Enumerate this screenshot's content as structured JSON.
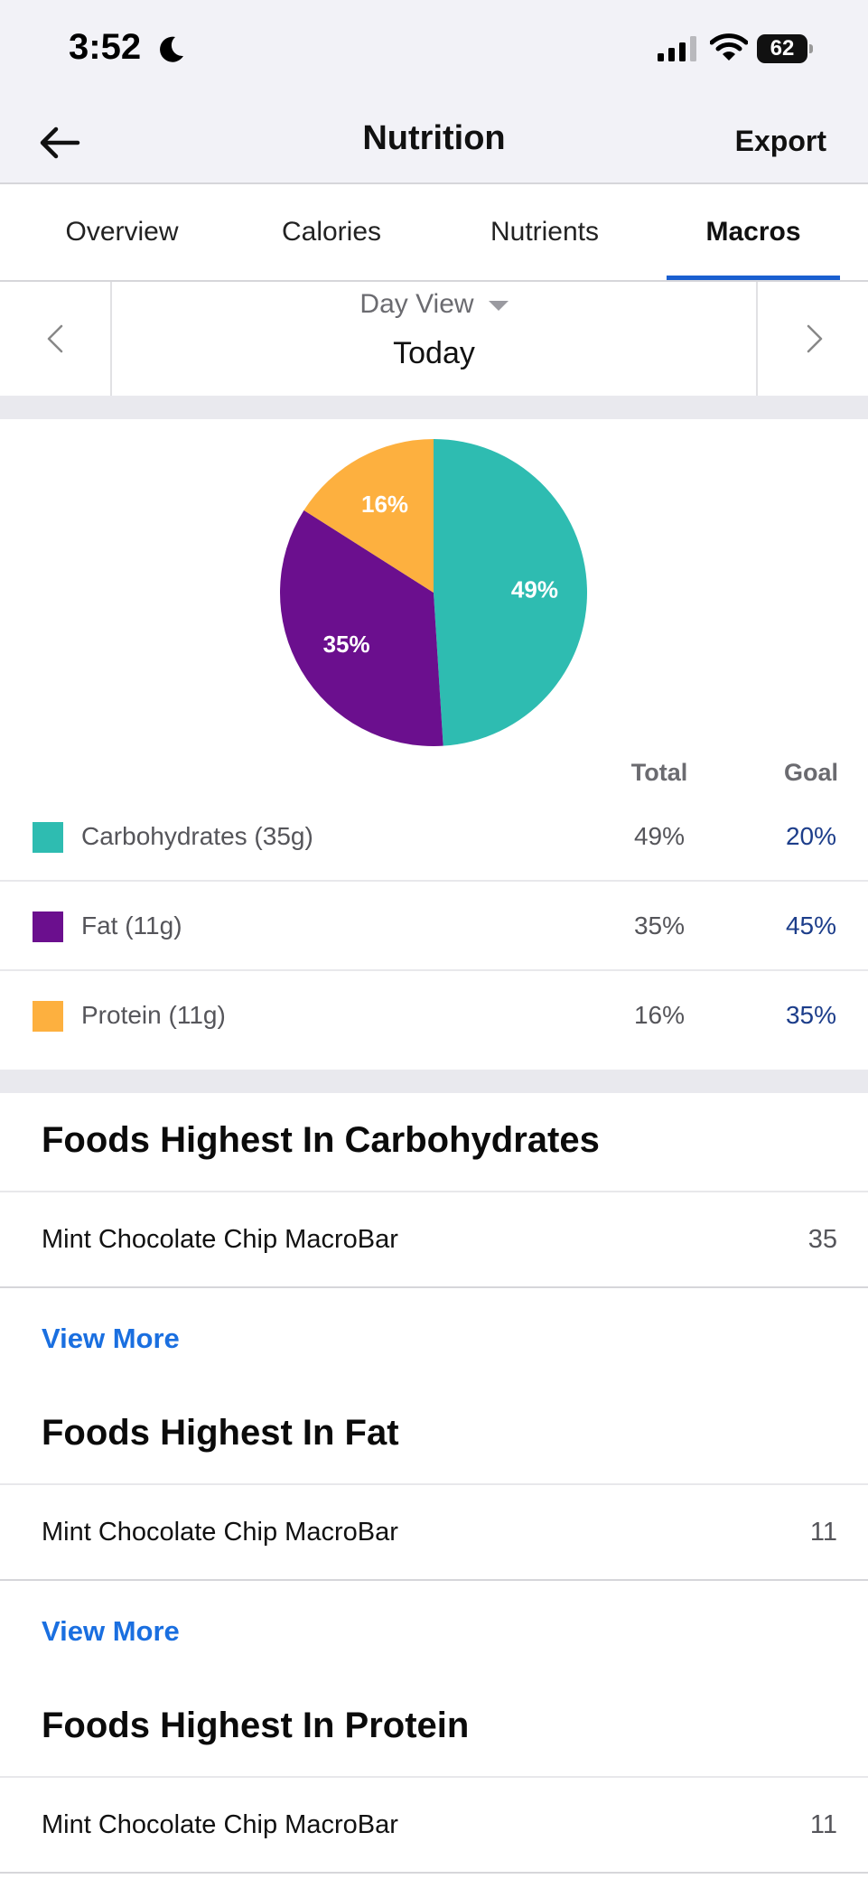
{
  "status_bar": {
    "time": "3:52",
    "battery": "62"
  },
  "header": {
    "title": "Nutrition",
    "export_label": "Export"
  },
  "tabs": [
    {
      "label": "Overview",
      "active": false
    },
    {
      "label": "Calories",
      "active": false
    },
    {
      "label": "Nutrients",
      "active": false
    },
    {
      "label": "Macros",
      "active": true
    }
  ],
  "day_selector": {
    "view_label": "Day View",
    "date_label": "Today"
  },
  "chart_data": {
    "type": "pie",
    "slices": [
      {
        "label": "Carbohydrates",
        "value": 49,
        "display": "49%",
        "color": "#2ebcb1"
      },
      {
        "label": "Fat",
        "value": 35,
        "display": "35%",
        "color": "#6b0f8e"
      },
      {
        "label": "Protein",
        "value": 16,
        "display": "16%",
        "color": "#fdb03f"
      }
    ]
  },
  "macros": {
    "total_header": "Total",
    "goal_header": "Goal",
    "rows": [
      {
        "name": "Carbohydrates (35g)",
        "total": "49%",
        "goal": "20%",
        "color": "#2ebcb1"
      },
      {
        "name": "Fat (11g)",
        "total": "35%",
        "goal": "45%",
        "color": "#6b0f8e"
      },
      {
        "name": "Protein (11g)",
        "total": "16%",
        "goal": "35%",
        "color": "#fdb03f"
      }
    ]
  },
  "sections": [
    {
      "title": "Foods Highest In Carbohydrates",
      "food": "Mint Chocolate Chip MacroBar",
      "value": "35",
      "view_more": "View More"
    },
    {
      "title": "Foods Highest In Fat",
      "food": "Mint Chocolate Chip MacroBar",
      "value": "11",
      "view_more": "View More"
    },
    {
      "title": "Foods Highest In Protein",
      "food": "Mint Chocolate Chip MacroBar",
      "value": "11"
    }
  ]
}
